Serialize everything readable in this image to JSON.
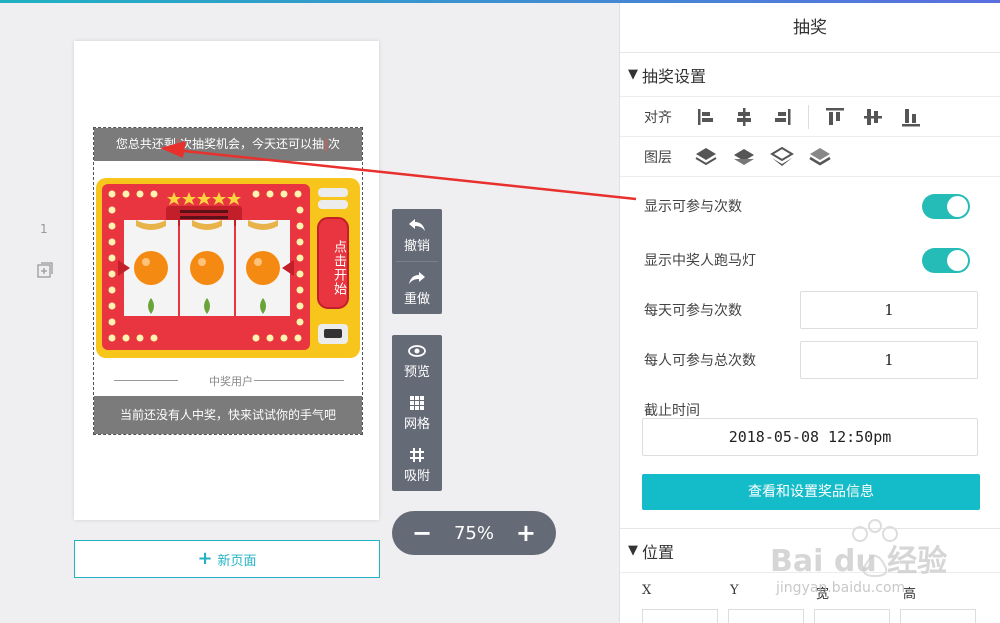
{
  "left": {
    "page_number": "1",
    "new_page_label": "新页面"
  },
  "canvas": {
    "count_text_pre": "您总共还剩",
    "count_text_mid": "次抽奖机会，今天还可以抽",
    "count_text_post": "次",
    "start_button": "点击开始",
    "winners_label": "中奖用户",
    "empty_winners": "当前还没有人中奖，快来试试你的手气吧"
  },
  "toolbar": {
    "undo": "撤销",
    "redo": "重做",
    "preview": "预览",
    "grid": "网格",
    "snap": "吸附",
    "zoom_level": "75%",
    "zoom_minus": "−",
    "zoom_plus": "+"
  },
  "panel": {
    "title": "抽奖",
    "section_lottery": "抽奖设置",
    "align_label": "对齐",
    "layer_label": "图层",
    "show_count_label": "显示可参与次数",
    "show_count_on": true,
    "show_marquee_label": "显示中奖人跑马灯",
    "show_marquee_on": true,
    "daily_label": "每天可参与次数",
    "daily_value": "1",
    "total_label": "每人可参与总次数",
    "total_value": "1",
    "deadline_label": "截止时间",
    "deadline_value": "2018-05-08 12:50pm",
    "prize_button": "查看和设置奖品信息",
    "section_position": "位置",
    "pos_x": "X",
    "pos_y": "Y",
    "pos_w": "宽",
    "pos_h": "高"
  },
  "watermark": {
    "brand": "Bai du 经验",
    "url": "jingyan.baidu.com"
  },
  "colors": {
    "accent": "#14bcc9",
    "toggle": "#25bcb8",
    "toolbar": "#656b76",
    "arrow": "#e8302d"
  }
}
